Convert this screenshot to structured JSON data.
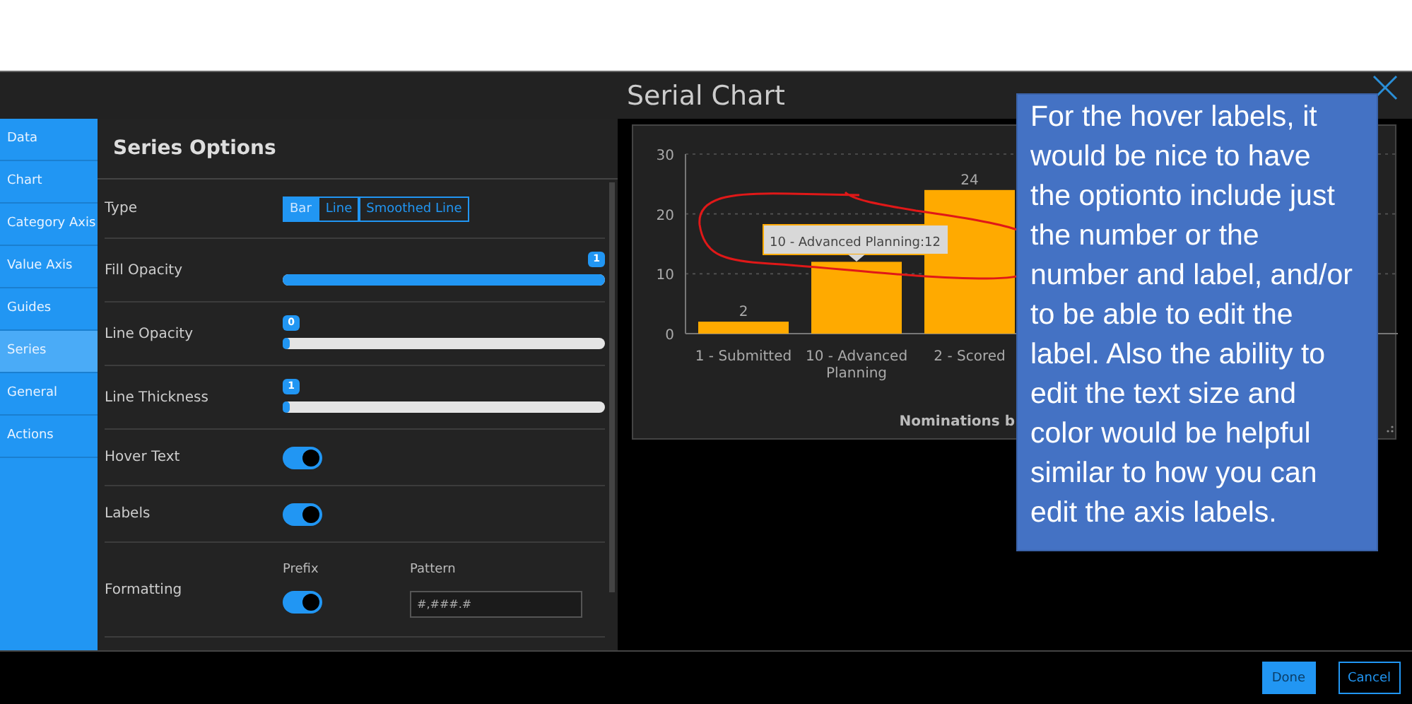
{
  "window": {
    "title": "Serial Chart"
  },
  "sidebar": {
    "items": [
      {
        "label": "Data",
        "selected": false
      },
      {
        "label": "Chart",
        "selected": false
      },
      {
        "label": "Category Axis",
        "selected": false
      },
      {
        "label": "Value Axis",
        "selected": false
      },
      {
        "label": "Guides",
        "selected": false
      },
      {
        "label": "Series",
        "selected": true
      },
      {
        "label": "General",
        "selected": false
      },
      {
        "label": "Actions",
        "selected": false
      }
    ]
  },
  "panel": {
    "title": "Series Options",
    "rows": [
      {
        "kind": "segments",
        "label": "Type",
        "options": [
          {
            "label": "Bar",
            "selected": true
          },
          {
            "label": "Line",
            "selected": false
          },
          {
            "label": "Smoothed Line",
            "selected": false
          }
        ]
      },
      {
        "kind": "slider",
        "label": "Fill Opacity",
        "level": 1,
        "reading": "1"
      },
      {
        "kind": "slider",
        "label": "Line Opacity",
        "level": 0,
        "reading": "0"
      },
      {
        "kind": "slider",
        "label": "Line Thickness",
        "level": 0,
        "reading": "1"
      },
      {
        "kind": "toggle",
        "label": "Hover Text",
        "on": true
      },
      {
        "kind": "toggle",
        "label": "Labels",
        "on": true
      },
      {
        "kind": "formatting",
        "label": "Formatting",
        "prefix_label": "Prefix",
        "prefix_on": true,
        "pattern_label": "Pattern",
        "pattern": "#,###.#"
      }
    ]
  },
  "chart": {
    "title": "Nominations b",
    "tooltip": "10 - Advanced Planning:12",
    "chart_data": {
      "type": "bar",
      "categories": [
        "1 - Submitted",
        "10 - Advanced Planning",
        "2 - Scored"
      ],
      "series": [
        {
          "color": "#ffaa00",
          "values": [
            2,
            12,
            24
          ]
        }
      ],
      "value_labels": [
        "2",
        null,
        "24"
      ],
      "ylim": [
        0,
        30
      ],
      "yticks": [
        0,
        10,
        20,
        30
      ]
    }
  },
  "callout": "For the hover labels, it would be nice to have the optionto include just the number or the number and label, and/or to be able to edit the label. Also the ability to edit the text size and color would be helpful similar to how you can edit the axis labels.",
  "buttons": [
    {
      "label": "Done",
      "kind": "primary"
    },
    {
      "label": "Cancel",
      "kind": "secondary"
    }
  ]
}
